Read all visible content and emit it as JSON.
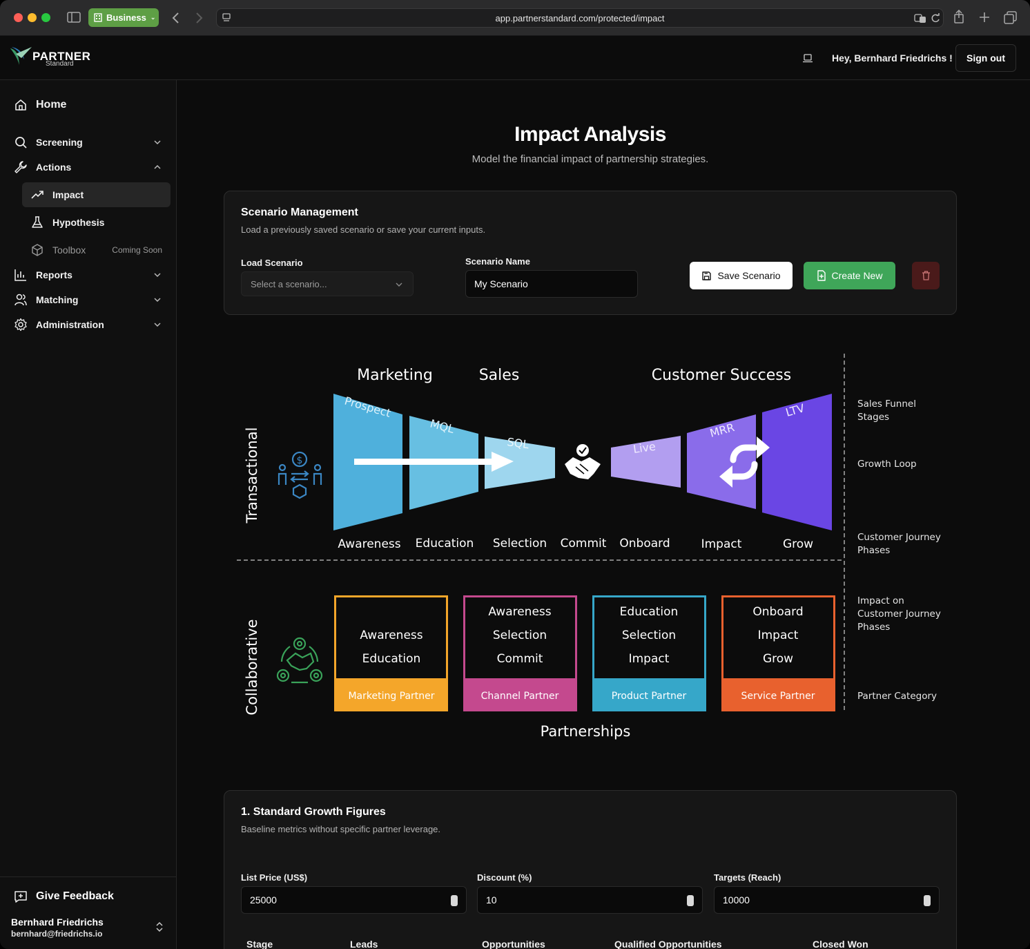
{
  "browser": {
    "profile_label": "Business",
    "url": "app.partnerstandard.com/protected/impact"
  },
  "header": {
    "logo_word": "PARTNER",
    "logo_sub": "Standard",
    "greeting": "Hey, Bernhard Friedrichs !",
    "signout": "Sign out"
  },
  "sidebar": {
    "home": "Home",
    "screening": "Screening",
    "actions": "Actions",
    "impact": "Impact",
    "hypothesis": "Hypothesis",
    "toolbox": "Toolbox",
    "coming_soon": "Coming Soon",
    "reports": "Reports",
    "matching": "Matching",
    "administration": "Administration",
    "feedback": "Give Feedback",
    "user_name": "Bernhard Friedrichs",
    "user_email": "bernhard@friedrichs.io"
  },
  "page": {
    "title": "Impact Analysis",
    "subtitle": "Model the financial impact of partnership strategies."
  },
  "scenario": {
    "title": "Scenario Management",
    "desc": "Load a previously saved scenario or save your current inputs.",
    "load_label": "Load Scenario",
    "load_placeholder": "Select a scenario...",
    "name_label": "Scenario Name",
    "name_value": "My Scenario",
    "save": "Save Scenario",
    "create": "Create New"
  },
  "diagram": {
    "headings": {
      "marketing": "Marketing",
      "sales": "Sales",
      "cs": "Customer Success"
    },
    "funnel_labels": [
      "Prospect",
      "MQL",
      "SQL",
      "Live",
      "MRR",
      "LTV"
    ],
    "phases": [
      "Awareness",
      "Education",
      "Selection",
      "Commit",
      "Onboard",
      "Impact",
      "Grow"
    ],
    "transactional": "Transactional",
    "collaborative": "Collaborative",
    "partnerships": "Partnerships",
    "boxes": [
      {
        "lines": [
          "Awareness",
          "Education"
        ],
        "footer": "Marketing Partner",
        "color": "#f4a62a"
      },
      {
        "lines": [
          "Awareness",
          "Selection",
          "Commit"
        ],
        "footer": "Channel Partner",
        "color": "#c4498e"
      },
      {
        "lines": [
          "Education",
          "Selection",
          "Impact"
        ],
        "footer": "Product Partner",
        "color": "#36a7c9"
      },
      {
        "lines": [
          "Onboard",
          "Impact",
          "Grow"
        ],
        "footer": "Service Partner",
        "color": "#e8612e"
      }
    ],
    "legend": {
      "funnel": "Sales Funnel\nStages",
      "loop": "Growth Loop",
      "phases": "Customer Journey\nPhases",
      "impact": "Impact on\nCustomer Journey\nPhases",
      "category": "Partner Category"
    }
  },
  "growth": {
    "title": "1. Standard Growth Figures",
    "desc": "Baseline metrics without specific partner leverage.",
    "list_price_label": "List Price (US$)",
    "list_price": "25000",
    "discount_label": "Discount (%)",
    "discount": "10",
    "targets_label": "Targets (Reach)",
    "targets": "10000",
    "table_headers": [
      "Stage",
      "Leads",
      "Opportunities",
      "Qualified Opportunities",
      "Closed Won"
    ]
  }
}
